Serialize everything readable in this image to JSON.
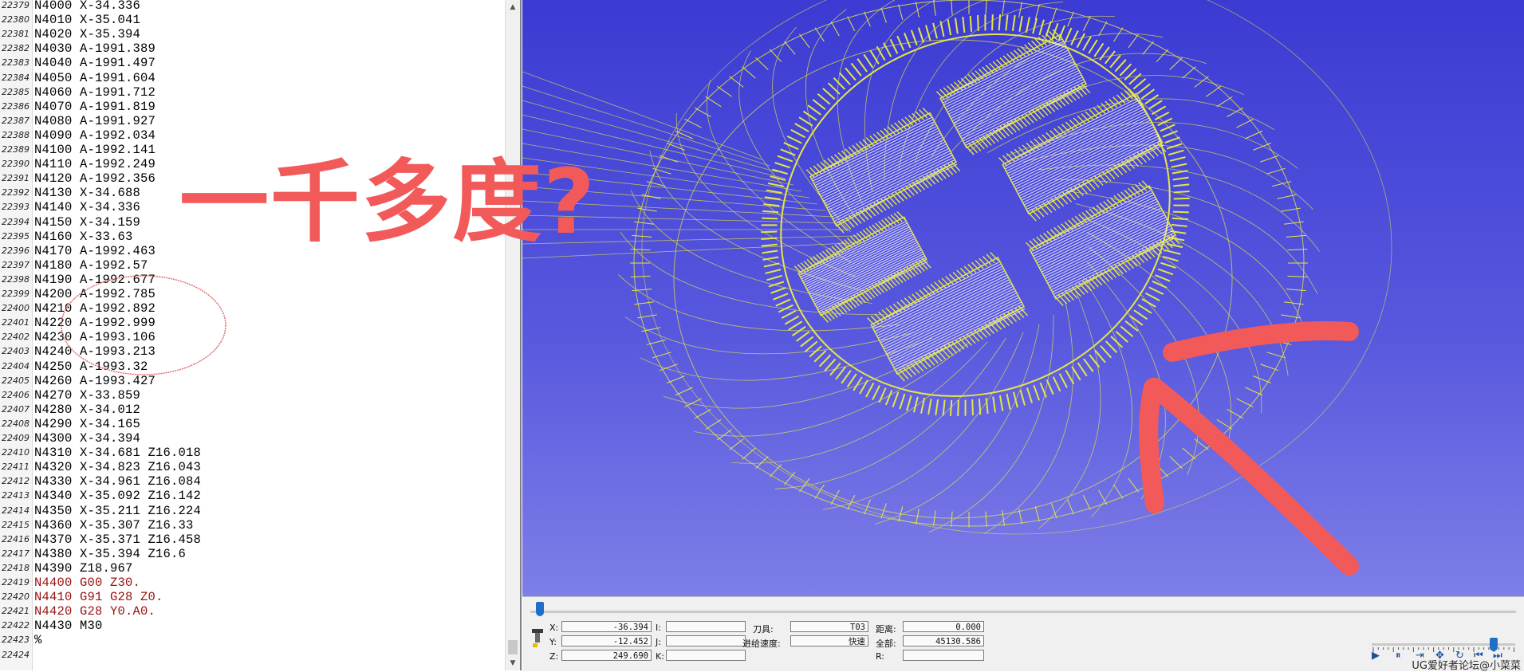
{
  "editor": {
    "lines": [
      {
        "num": "22379",
        "text": "N4000 X-34.336"
      },
      {
        "num": "22380",
        "text": "N4010 X-35.041"
      },
      {
        "num": "22381",
        "text": "N4020 X-35.394"
      },
      {
        "num": "22382",
        "text": "N4030 A-1991.389"
      },
      {
        "num": "22383",
        "text": "N4040 A-1991.497"
      },
      {
        "num": "22384",
        "text": "N4050 A-1991.604"
      },
      {
        "num": "22385",
        "text": "N4060 A-1991.712"
      },
      {
        "num": "22386",
        "text": "N4070 A-1991.819"
      },
      {
        "num": "22387",
        "text": "N4080 A-1991.927"
      },
      {
        "num": "22388",
        "text": "N4090 A-1992.034"
      },
      {
        "num": "22389",
        "text": "N4100 A-1992.141"
      },
      {
        "num": "22390",
        "text": "N4110 A-1992.249"
      },
      {
        "num": "22391",
        "text": "N4120 A-1992.356"
      },
      {
        "num": "22392",
        "text": "N4130 X-34.688"
      },
      {
        "num": "22393",
        "text": "N4140 X-34.336"
      },
      {
        "num": "22394",
        "text": "N4150 X-34.159"
      },
      {
        "num": "22395",
        "text": "N4160 X-33.63"
      },
      {
        "num": "22396",
        "text": "N4170 A-1992.463"
      },
      {
        "num": "22397",
        "text": "N4180 A-1992.57"
      },
      {
        "num": "22398",
        "text": "N4190 A-1992.677"
      },
      {
        "num": "22399",
        "text": "N4200 A-1992.785"
      },
      {
        "num": "22400",
        "text": "N4210 A-1992.892"
      },
      {
        "num": "22401",
        "text": "N4220 A-1992.999"
      },
      {
        "num": "22402",
        "text": "N4230 A-1993.106"
      },
      {
        "num": "22403",
        "text": "N4240 A-1993.213"
      },
      {
        "num": "22404",
        "text": "N4250 A-1993.32"
      },
      {
        "num": "22405",
        "text": "N4260 A-1993.427"
      },
      {
        "num": "22406",
        "text": "N4270 X-33.859"
      },
      {
        "num": "22407",
        "text": "N4280 X-34.012"
      },
      {
        "num": "22408",
        "text": "N4290 X-34.165"
      },
      {
        "num": "22409",
        "text": "N4300 X-34.394"
      },
      {
        "num": "22410",
        "text": "N4310 X-34.681 Z16.018"
      },
      {
        "num": "22411",
        "text": "N4320 X-34.823 Z16.043"
      },
      {
        "num": "22412",
        "text": "N4330 X-34.961 Z16.084"
      },
      {
        "num": "22413",
        "text": "N4340 X-35.092 Z16.142"
      },
      {
        "num": "22414",
        "text": "N4350 X-35.211 Z16.224"
      },
      {
        "num": "22415",
        "text": "N4360 X-35.307 Z16.33"
      },
      {
        "num": "22416",
        "text": "N4370 X-35.371 Z16.458"
      },
      {
        "num": "22417",
        "text": "N4380 X-35.394 Z16.6"
      },
      {
        "num": "22418",
        "text": "N4390 Z18.967"
      },
      {
        "num": "22419",
        "text": "N4400 G00 Z30.",
        "red": true
      },
      {
        "num": "22420",
        "text": "N4410 G91 G28 Z0.",
        "red": true
      },
      {
        "num": "22421",
        "text": "N4420 G28 Y0.A0.",
        "red": true
      },
      {
        "num": "22422",
        "text": "N4430 M30"
      },
      {
        "num": "22423",
        "text": "%"
      },
      {
        "num": "22424",
        "text": ""
      }
    ]
  },
  "annotation": {
    "caption": "一千多度?",
    "color": "#f25a5a"
  },
  "viewport": {
    "background_top": "#3b3bd3",
    "background_bottom": "#7e7ee8",
    "toolpath_color": "#e5e645"
  },
  "status_panel": {
    "x_label": "X:",
    "x_value": "-36.394",
    "y_label": "Y:",
    "y_value": "-12.452",
    "z_label": "Z:",
    "z_value": "249.690",
    "i_label": "I:",
    "i_value": "",
    "j_label": "J:",
    "j_value": "",
    "k_label": "K:",
    "k_value": "",
    "tool_label": "刀具:",
    "tool_value": "T03",
    "feed_label": "进给速度:",
    "feed_value": "快速",
    "dist_label": "距离:",
    "dist_value": "0.000",
    "total_label": "全部:",
    "total_value": "45130.586",
    "r_label": "R:",
    "r_value": ""
  },
  "playback": {
    "progress": 0.01,
    "speed": 0.85,
    "icons": [
      "play-icon",
      "step-back-icon",
      "step-forward-icon",
      "settings-icon",
      "loop-icon",
      "rewind-icon",
      "fast-forward-icon"
    ]
  },
  "watermark": "UG爱好者论坛@小菜菜"
}
